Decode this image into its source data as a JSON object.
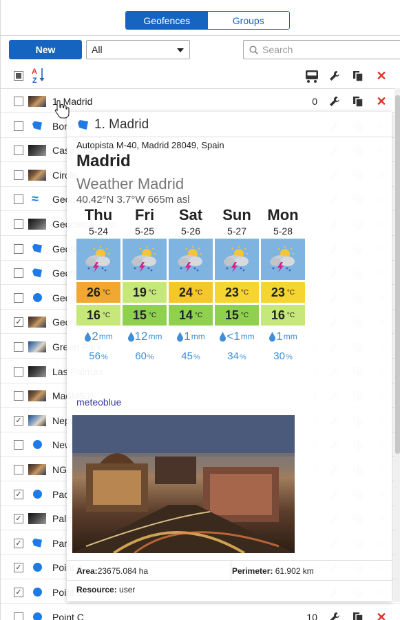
{
  "tabs": [
    {
      "label": "Geofences",
      "active": true
    },
    {
      "label": "Groups",
      "active": false
    }
  ],
  "toolbar": {
    "new_label": "New",
    "filter_value": "All",
    "search_placeholder": "Search"
  },
  "header": {
    "sort_icon": "A-Z",
    "columns": [
      "vehicle-icon",
      "wrench-icon",
      "copy-icon",
      "delete-icon"
    ]
  },
  "rows": [
    {
      "name": "1. Madrid",
      "count": "0",
      "checked": false,
      "icon": "photo"
    },
    {
      "name": "Bone",
      "count": "0",
      "checked": false,
      "icon": "shape"
    },
    {
      "name": "Casa Mia",
      "count": "0",
      "checked": false,
      "icon": "photo"
    },
    {
      "name": "Circle",
      "count": "0",
      "checked": false,
      "icon": "photo"
    },
    {
      "name": "Geocerca",
      "count": "0",
      "checked": false,
      "icon": "squiggle"
    },
    {
      "name": "Geocerca ... st.",
      "count": "0",
      "checked": false,
      "icon": "photo"
    },
    {
      "name": "Geofence 1",
      "count": "0",
      "checked": false,
      "icon": "shape"
    },
    {
      "name": "Geofence 2",
      "count": "0",
      "checked": false,
      "icon": "shape"
    },
    {
      "name": "Geofence 3",
      "count": "0",
      "checked": false,
      "icon": "circle"
    },
    {
      "name": "Geofence Amster",
      "count": "0",
      "checked": true,
      "icon": "photo"
    },
    {
      "name": "Green Park",
      "count": "0",
      "checked": false,
      "icon": "photo"
    },
    {
      "name": "Las Palmas",
      "count": "0",
      "checked": false,
      "icon": "photo"
    },
    {
      "name": "MadM503",
      "count": "1",
      "checked": false,
      "icon": "photo"
    },
    {
      "name": "Nepal",
      "count": "0",
      "checked": true,
      "icon": "photo"
    },
    {
      "name": "New geofence",
      "count": "0",
      "checked": false,
      "icon": "circle"
    },
    {
      "name": "NGeo",
      "count": "0",
      "checked": false,
      "icon": "photo"
    },
    {
      "name": "Pac",
      "count": "0",
      "checked": true,
      "icon": "circle"
    },
    {
      "name": "Palm",
      "count": "0",
      "checked": true,
      "icon": "photo"
    },
    {
      "name": "Park",
      "count": "1",
      "checked": true,
      "icon": "shape"
    },
    {
      "name": "Point A",
      "count": "0",
      "checked": true,
      "icon": "circle"
    },
    {
      "name": "Point B",
      "count": "0",
      "checked": true,
      "icon": "circle"
    },
    {
      "name": "Point C",
      "count": "10",
      "checked": false,
      "icon": "circle"
    }
  ],
  "popup": {
    "title": "1. Madrid",
    "address": "Autopista M-40, Madrid 28049, Spain",
    "city": "Madrid",
    "weather_title": "Weather Madrid",
    "coords": "40.42°N 3.7°W 665m asl",
    "days": [
      {
        "name": "Thu",
        "date": "5-24",
        "tmax": "26",
        "tmin": "16",
        "rain": "2",
        "hum": "56",
        "tmax_color": "#f0a830",
        "tmin_color": "#c6e87a"
      },
      {
        "name": "Fri",
        "date": "5-25",
        "tmax": "19",
        "tmin": "15",
        "rain": "12",
        "hum": "60",
        "tmax_color": "#c6e87a",
        "tmin_color": "#8fd14f"
      },
      {
        "name": "Sat",
        "date": "5-26",
        "tmax": "24",
        "tmin": "14",
        "rain": "1",
        "hum": "45",
        "tmax_color": "#f6c728",
        "tmin_color": "#8fd14f"
      },
      {
        "name": "Sun",
        "date": "5-27",
        "tmax": "23",
        "tmin": "15",
        "rain": "<1",
        "hum": "34",
        "tmax_color": "#f6d52e",
        "tmin_color": "#8fd14f"
      },
      {
        "name": "Mon",
        "date": "5-28",
        "tmax": "23",
        "tmin": "16",
        "rain": "1",
        "hum": "30",
        "tmax_color": "#f6d52e",
        "tmin_color": "#c6e87a"
      }
    ],
    "temp_unit": "°C",
    "rain_unit": "mm",
    "hum_unit": "%",
    "credit": "meteoblue",
    "area_label": "Area:",
    "area_value": "23675.084 ha",
    "perimeter_label": "Perimeter:",
    "perimeter_value": "61.902 km",
    "resource_label": "Resource:",
    "resource_value": "user"
  },
  "colors": {
    "accent": "#1565c0",
    "delete": "#e5302a",
    "icon_blue": "#1e7be6"
  }
}
